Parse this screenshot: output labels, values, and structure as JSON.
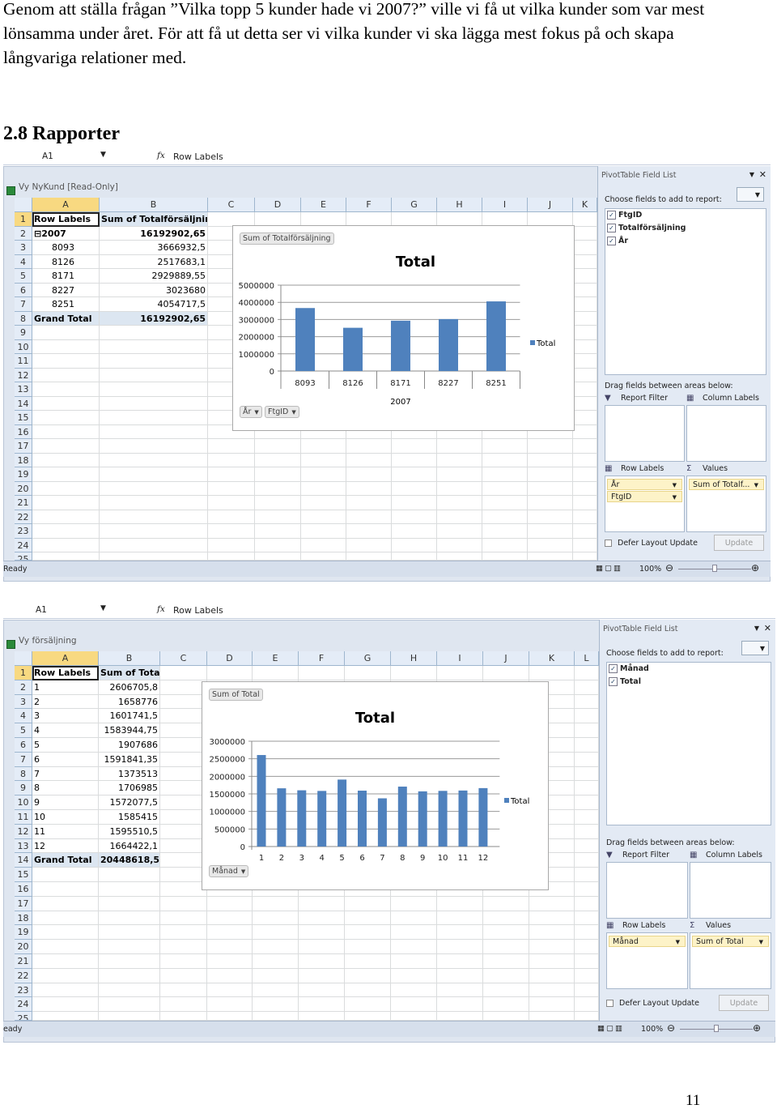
{
  "document": {
    "paragraph": "Genom att ställa frågan ”Vilka topp 5 kunder hade vi 2007?” ville vi få ut vilka kunder som var mest lönsamma under året. För att få ut detta ser vi vilka kunder vi ska lägga mest fokus på och skapa långvariga relationer med.",
    "heading": "2.8 Rapporter",
    "page_number": "11"
  },
  "screens": [
    {
      "name_box": "A1",
      "fx": "fx",
      "formula": "Row Labels",
      "window_title": "Vy NyKund  [Read-Only]",
      "columns": [
        "A",
        "B",
        "C",
        "D",
        "E",
        "F",
        "G",
        "H",
        "I",
        "J",
        "K"
      ],
      "row_numbers": [
        "1",
        "2",
        "3",
        "4",
        "5",
        "6",
        "7",
        "8",
        "9",
        "10",
        "11",
        "12",
        "13",
        "14",
        "15",
        "16",
        "17",
        "18",
        "19",
        "20",
        "21",
        "22",
        "23",
        "24",
        "25"
      ],
      "pivot": [
        [
          "Row Labels",
          "Sum of Totalförsäljning"
        ],
        [
          "⊟2007",
          "16192902,65"
        ],
        [
          "8093",
          "3666932,5"
        ],
        [
          "8126",
          "2517683,1"
        ],
        [
          "8171",
          "2929889,55"
        ],
        [
          "8227",
          "3023680"
        ],
        [
          "8251",
          "4054717,5"
        ],
        [
          "Grand Total",
          "16192902,65"
        ]
      ],
      "chart": {
        "type": "bar",
        "title": "Total",
        "value_button": "Sum of Totalförsäljning",
        "categories": [
          "8093",
          "8126",
          "8171",
          "8227",
          "8251"
        ],
        "group_label": "2007",
        "values": [
          3666932.5,
          2517683.1,
          2929889.55,
          3023680,
          4054717.5
        ],
        "ylim": [
          0,
          5000000
        ],
        "yticks": [
          "0",
          "1000000",
          "2000000",
          "3000000",
          "4000000",
          "5000000"
        ],
        "legend": "Total",
        "legend_position": "right",
        "axis_buttons": [
          "År",
          "FtgID"
        ],
        "color": "#4f81bd",
        "grid": true
      },
      "field_list": {
        "title": "PivotTable Field List",
        "choose": "Choose fields to add to report:",
        "fields": [
          "FtgID",
          "Totalförsäljning",
          "År"
        ],
        "drag": "Drag fields between areas below:",
        "report_filter": "Report Filter",
        "column_labels": "Column Labels",
        "row_labels": "Row Labels",
        "values": "Values",
        "row_items": [
          "År",
          "FtgID"
        ],
        "value_items": [
          "Sum of Totalf..."
        ],
        "defer": "Defer Layout Update",
        "update": "Update"
      },
      "status": {
        "ready": "Ready",
        "zoom": "100%"
      }
    },
    {
      "name_box": "A1",
      "fx": "fx",
      "formula": "Row Labels",
      "window_title": "Vy försäljning",
      "columns": [
        "A",
        "B",
        "C",
        "D",
        "E",
        "F",
        "G",
        "H",
        "I",
        "J",
        "K",
        "L"
      ],
      "row_numbers": [
        "1",
        "2",
        "3",
        "4",
        "5",
        "6",
        "7",
        "8",
        "9",
        "10",
        "11",
        "12",
        "13",
        "14",
        "15",
        "16",
        "17",
        "18",
        "19",
        "20",
        "21",
        "22",
        "23",
        "24",
        "25"
      ],
      "pivot": [
        [
          "Row Labels",
          "Sum of Total"
        ],
        [
          "1",
          "2606705,8"
        ],
        [
          "2",
          "1658776"
        ],
        [
          "3",
          "1601741,5"
        ],
        [
          "4",
          "1583944,75"
        ],
        [
          "5",
          "1907686"
        ],
        [
          "6",
          "1591841,35"
        ],
        [
          "7",
          "1373513"
        ],
        [
          "8",
          "1706985"
        ],
        [
          "9",
          "1572077,5"
        ],
        [
          "10",
          "1585415"
        ],
        [
          "11",
          "1595510,5"
        ],
        [
          "12",
          "1664422,1"
        ],
        [
          "Grand Total",
          "20448618,5"
        ]
      ],
      "chart": {
        "type": "bar",
        "title": "Total",
        "value_button": "Sum of Total",
        "categories": [
          "1",
          "2",
          "3",
          "4",
          "5",
          "6",
          "7",
          "8",
          "9",
          "10",
          "11",
          "12"
        ],
        "group_label": "",
        "values": [
          2606705.8,
          1658776,
          1601741.5,
          1583944.75,
          1907686,
          1591841.35,
          1373513,
          1706985,
          1572077.5,
          1585415,
          1595510.5,
          1664422.1
        ],
        "ylim": [
          0,
          3000000
        ],
        "yticks": [
          "0",
          "500000",
          "1000000",
          "1500000",
          "2000000",
          "2500000",
          "3000000"
        ],
        "legend": "Total",
        "legend_position": "right",
        "axis_buttons": [
          "Månad"
        ],
        "color": "#4f81bd",
        "grid": true
      },
      "field_list": {
        "title": "PivotTable Field List",
        "choose": "Choose fields to add to report:",
        "fields": [
          "Månad",
          "Total"
        ],
        "drag": "Drag fields between areas below:",
        "report_filter": "Report Filter",
        "column_labels": "Column Labels",
        "row_labels": "Row Labels",
        "values": "Values",
        "row_items": [
          "Månad"
        ],
        "value_items": [
          "Sum of Total"
        ],
        "defer": "Defer Layout Update",
        "update": "Update"
      },
      "status": {
        "ready": "eady",
        "zoom": "100%"
      }
    }
  ]
}
